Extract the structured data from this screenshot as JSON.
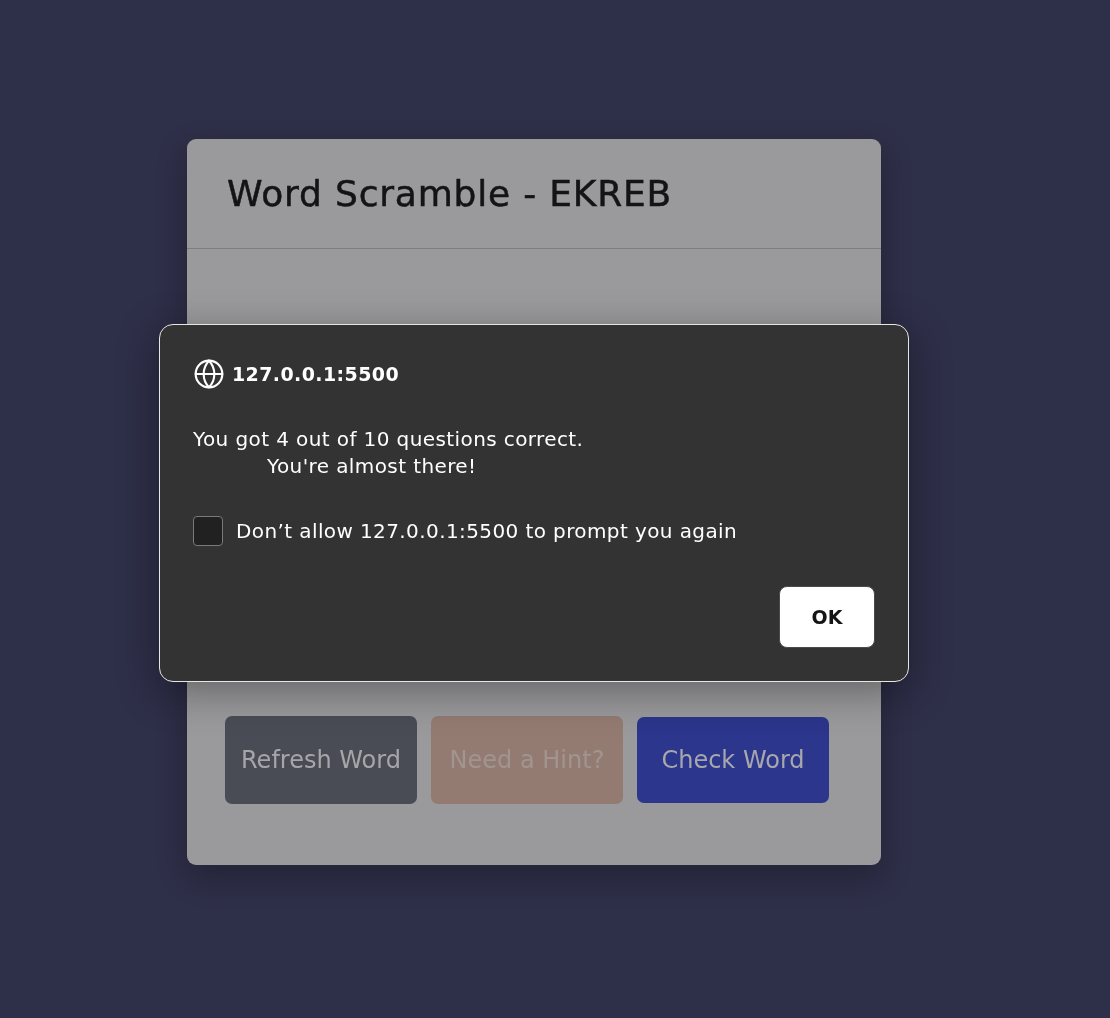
{
  "page": {
    "title": "Word Scramble - EKREB",
    "buttons": [
      {
        "label": "Refresh Word",
        "kind": "refresh"
      },
      {
        "label": "Need a Hint?",
        "kind": "hint"
      },
      {
        "label": "Check Word",
        "kind": "check"
      }
    ]
  },
  "dialog": {
    "origin": "127.0.0.1:5500",
    "message_lines": [
      "You got 4 out of 10 questions correct.",
      "You're almost there!"
    ],
    "checkbox": {
      "label": "Don’t allow 127.0.0.1:5500 to prompt you again",
      "checked": false
    },
    "buttons": [
      {
        "label": "OK"
      }
    ]
  }
}
